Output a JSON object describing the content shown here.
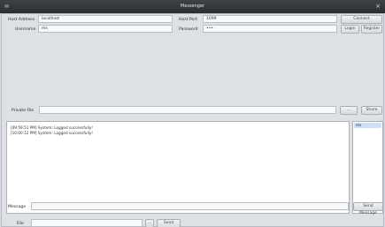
{
  "window": {
    "title": "Messenger"
  },
  "connection": {
    "host_address_label": "Host Address",
    "host_address_value": "localhost",
    "host_port_label": "Host Port",
    "host_port_value": "1099",
    "username_label": "Username",
    "username_value": "ms",
    "password_label": "Password",
    "password_value": "•••",
    "connect_label": "Connect",
    "login_label": "Login",
    "register_label": "Register"
  },
  "private_file": {
    "label": "Private File",
    "path_value": "",
    "browse_label": "...",
    "share_label": "Share"
  },
  "chat": {
    "log": [
      "[09:59:51 PM]   System: Logged successfully!",
      "[10:00:12 PM]   System: Logged successfully!"
    ]
  },
  "users": [
    "ms"
  ],
  "compose": {
    "message_label": "Message",
    "message_value": "",
    "send_message_label": "Send Message"
  },
  "file_send": {
    "label": "File",
    "path_value": "",
    "browse_label": "...",
    "send_label": "Send"
  }
}
